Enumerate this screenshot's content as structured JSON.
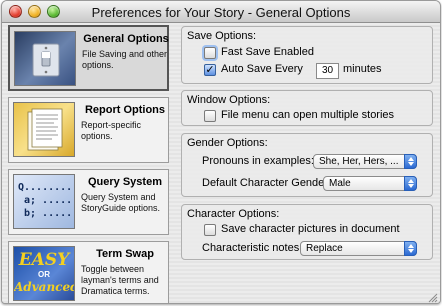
{
  "window": {
    "title": "Preferences for Your Story - General Options"
  },
  "sidebar": {
    "items": [
      {
        "title": "General Options",
        "desc": "File Saving and other options.",
        "icon": "light-switch-icon"
      },
      {
        "title": "Report Options",
        "desc": "Report-specific options.",
        "icon": "report-pages-icon"
      },
      {
        "title": "Query System",
        "desc": "Query System and StoryGuide options.",
        "icon": "query-form-icon"
      },
      {
        "title": "Term Swap",
        "desc": "Toggle between layman's terms and Dramatica terms.",
        "icon": "easy-advanced-icon"
      }
    ],
    "query_thumb": {
      "line1": "Q...........?",
      "line2": "a; .....",
      "line3": "b; ....."
    },
    "term_thumb": {
      "easy": "EASY",
      "or": "OR",
      "advanced": "Advanced"
    }
  },
  "save_options": {
    "title": "Save Options:",
    "fast_save_label": "Fast Save Enabled",
    "fast_save_checked": false,
    "auto_save_label": "Auto Save Every",
    "auto_save_checked": true,
    "auto_save_value": "30",
    "minutes_label": "minutes"
  },
  "window_options": {
    "title": "Window Options:",
    "multi_story_label": "File menu can open multiple stories",
    "multi_story_checked": false
  },
  "gender_options": {
    "title": "Gender Options:",
    "pronouns_label": "Pronouns in examples:",
    "pronouns_value": "She, Her, Hers, ...",
    "default_gender_label": "Default Character Gender:",
    "default_gender_value": "Male"
  },
  "character_options": {
    "title": "Character Options:",
    "save_pictures_label": "Save character pictures in document",
    "save_pictures_checked": false,
    "notes_label": "Characteristic notes:",
    "notes_value": "Replace"
  },
  "colors": {
    "accent": "#2c6ad2",
    "window_bg": "#e8e8e8"
  }
}
